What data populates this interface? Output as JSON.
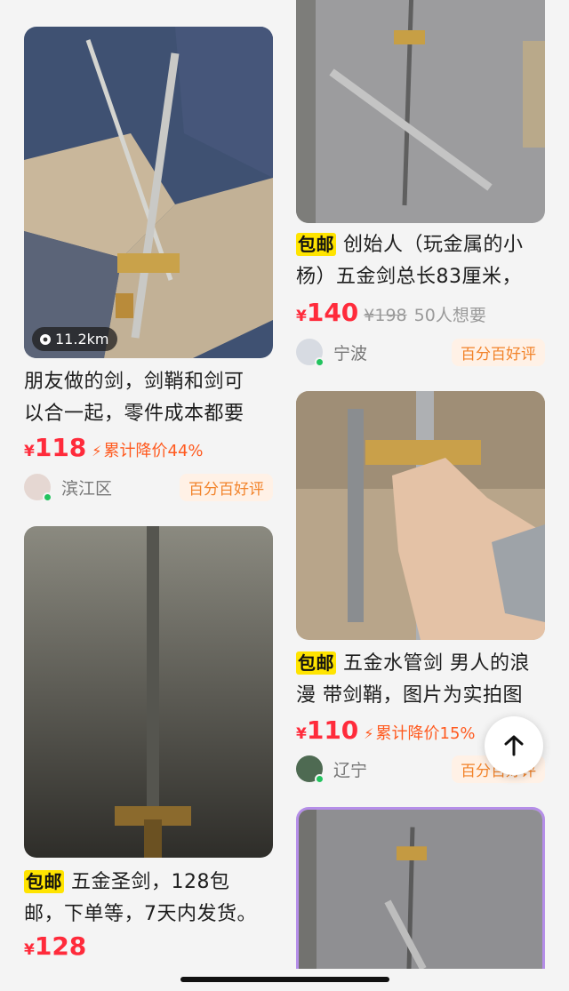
{
  "colors": {
    "price_red": "#ff2b3b",
    "badge_orange": "#f2832a",
    "baoyou_yellow": "#ffe400",
    "online_green": "#22c35e"
  },
  "feed": {
    "left": [
      {
        "distance": "11.2km",
        "title_lines": [
          "朋友做的剑，剑鞘和剑可",
          "以合一起，零件成本都要"
        ],
        "yen": "¥",
        "price": "118",
        "drop_label": "累计降价44%",
        "location": "滨江区",
        "badge": "百分百好评"
      },
      {
        "tag": "包邮",
        "title_lines": [
          "五金圣剑，128包",
          "邮，下单等，7天内发货。"
        ],
        "yen": "¥",
        "price": "128"
      }
    ],
    "right": [
      {
        "tag": "包邮",
        "title_lines": [
          "创始人（玩金属的小",
          "杨）五金剑总长83厘米，"
        ],
        "yen": "¥",
        "price": "140",
        "original_price": "¥198",
        "want_count": "50人想要",
        "location": "宁波",
        "badge": "百分百好评"
      },
      {
        "tag": "包邮",
        "title_lines": [
          "五金水管剑 男人的浪",
          "漫 带剑鞘，图片为实拍图"
        ],
        "yen": "¥",
        "price": "110",
        "drop_label": "累计降价15%",
        "location": "辽宁",
        "badge": "百分百好评"
      }
    ]
  },
  "icons": {
    "back_to_top": "arrow-up-icon",
    "distance": "location-pin-icon",
    "drop": "lightning-icon"
  }
}
